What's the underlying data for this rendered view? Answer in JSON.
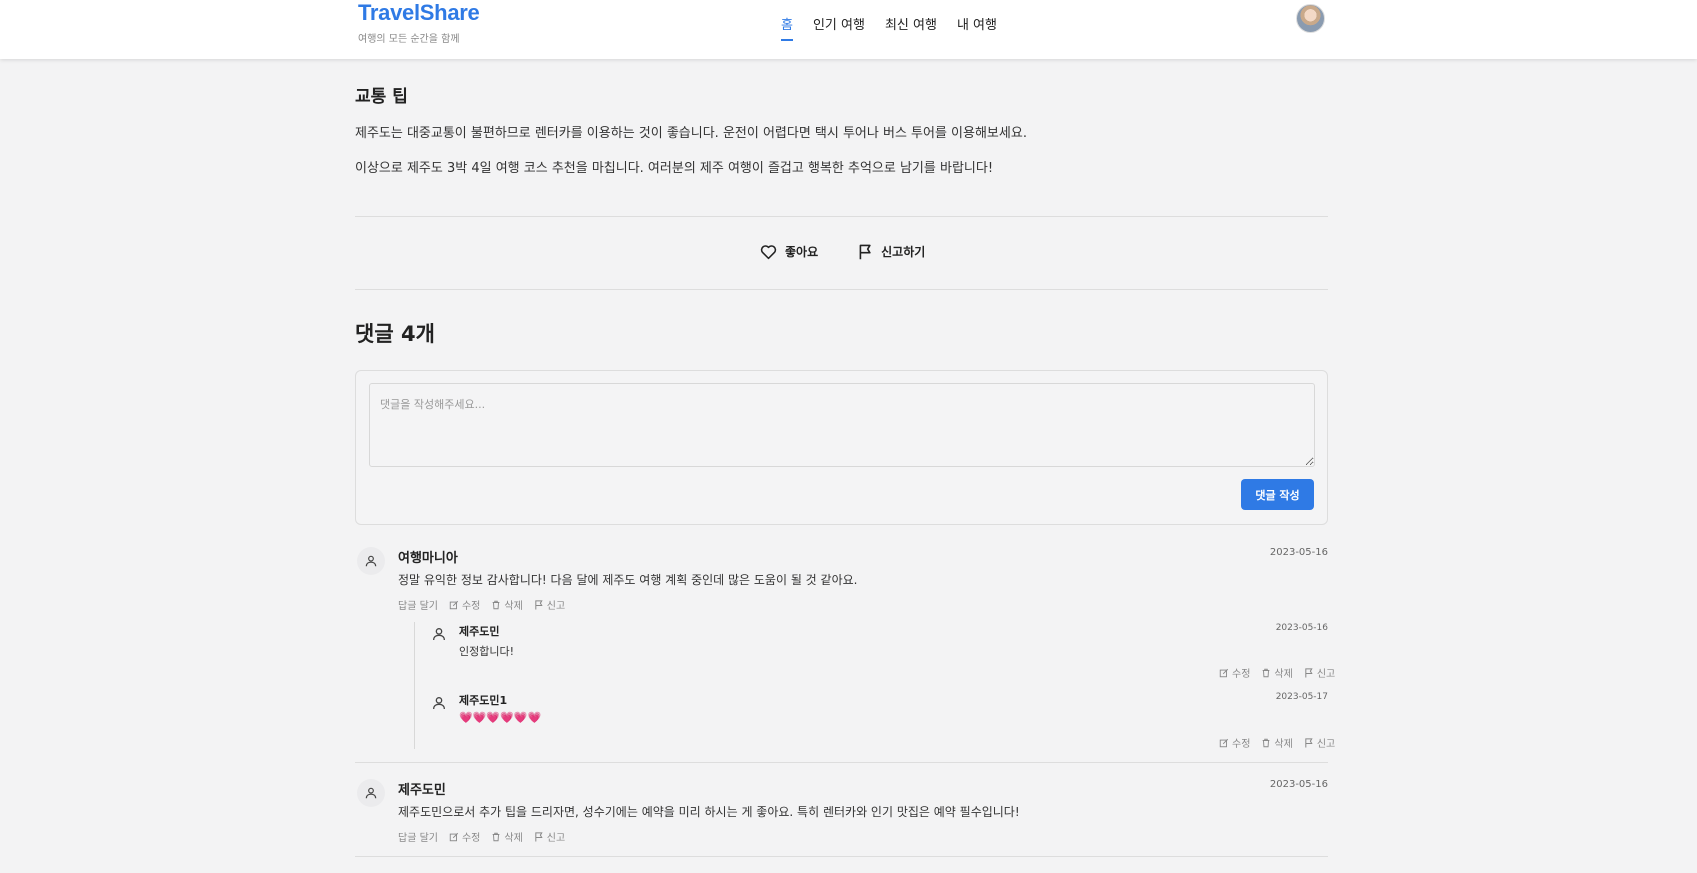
{
  "header": {
    "logo": "TravelShare",
    "tagline": "여행의 모든 순간을 함께",
    "nav": [
      "홈",
      "인기 여행",
      "최신 여행",
      "내 여행"
    ]
  },
  "post": {
    "section_title": "교통 팁",
    "paragraph1": "제주도는 대중교통이 불편하므로 렌터카를 이용하는 것이 좋습니다. 운전이 어렵다면 택시 투어나 버스 투어를 이용해보세요.",
    "paragraph2": "이상으로 제주도 3박 4일 여행 코스 추천을 마칩니다. 여러분의 제주 여행이 즐겁고 행복한 추억으로 남기를 바랍니다!",
    "like_label": "좋아요",
    "report_label": "신고하기"
  },
  "comments": {
    "title": "댓글 4개",
    "placeholder": "댓글을 작성해주세요...",
    "submit_label": "댓글 작성",
    "labels": {
      "reply": "답글 달기",
      "edit": "수정",
      "delete": "삭제",
      "report": "신고"
    },
    "items": [
      {
        "author": "여행마니아",
        "date": "2023-05-16",
        "text": "정말 유익한 정보 감사합니다! 다음 달에 제주도 여행 계획 중인데 많은 도움이 될 것 같아요.",
        "replies": [
          {
            "author": "제주도민",
            "date": "2023-05-16",
            "text": "인정합니다!"
          },
          {
            "author": "제주도민1",
            "date": "2023-05-17",
            "text": "💗💗💗💗💗💗"
          }
        ]
      },
      {
        "author": "제주도민",
        "date": "2023-05-16",
        "text": "제주도민으로서 추가 팁을 드리자면, 성수기에는 예약을 미리 하시는 게 좋아요. 특히 렌터카와 인기 맛집은 예약 필수입니다!"
      }
    ]
  },
  "colors": {
    "accent": "#2f7ae5",
    "background": "#f3f3f4"
  }
}
